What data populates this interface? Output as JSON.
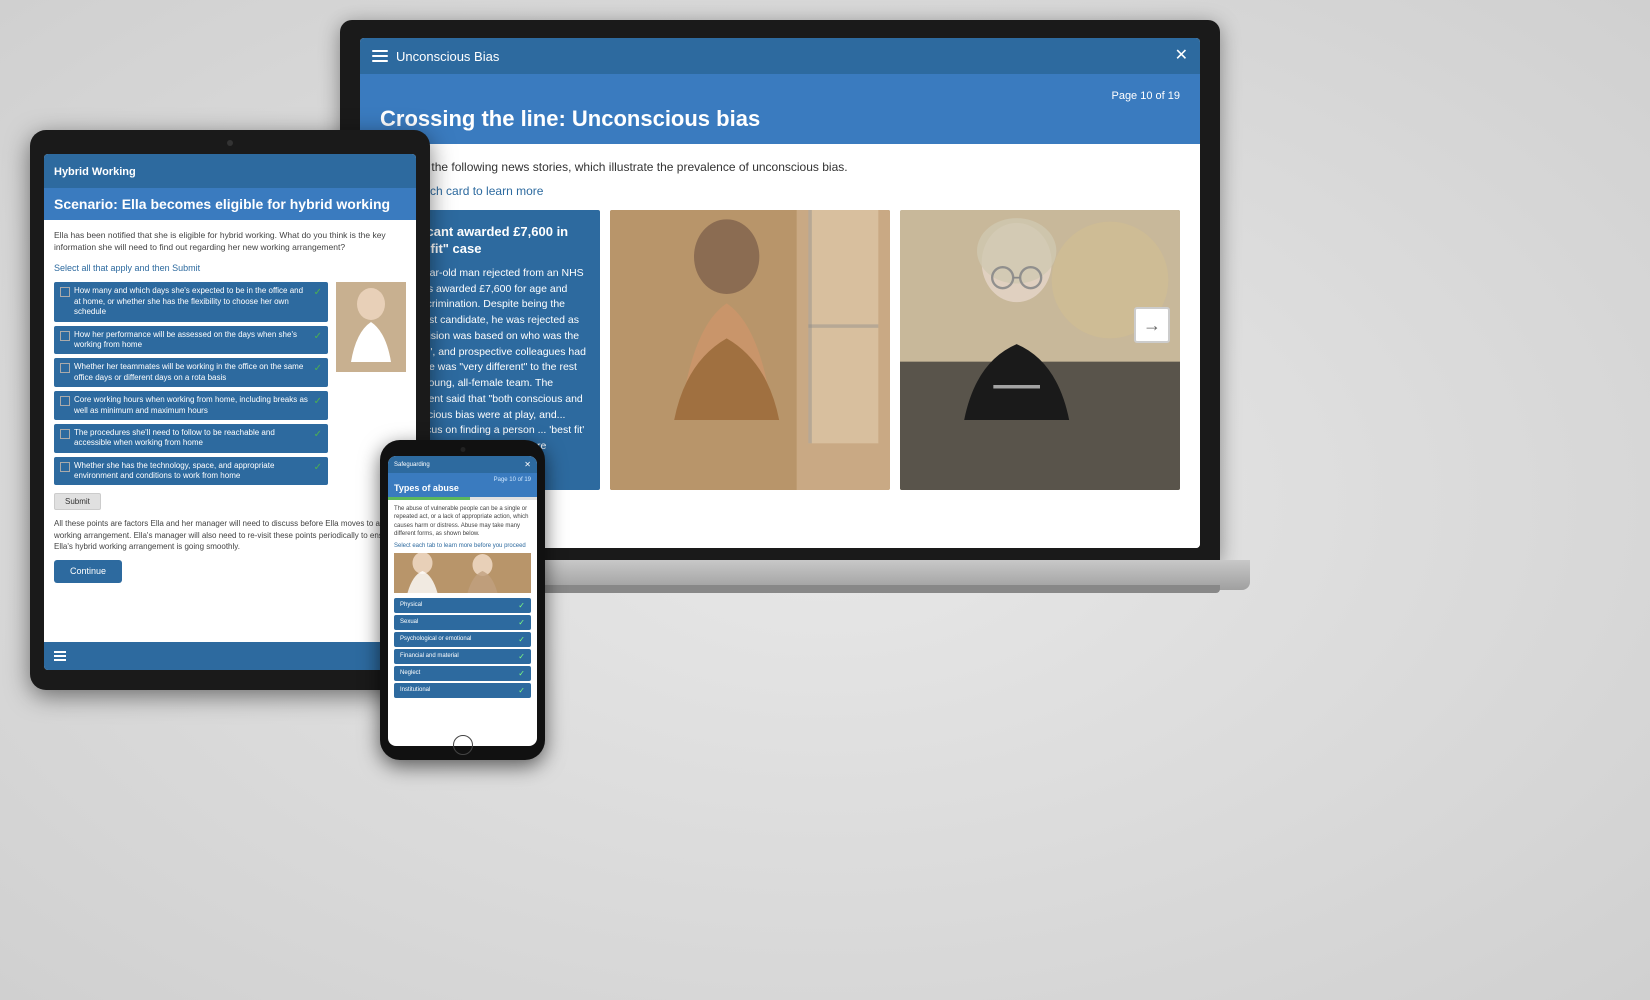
{
  "app": {
    "title": "Unconscious Bias",
    "close_label": "✕"
  },
  "laptop": {
    "header": {
      "title": "Unconscious Bias",
      "close": "✕"
    },
    "page_number": "Page 10 of 19",
    "page_title": "Crossing the line: Unconscious bias",
    "description": "Consider the following news stories, which illustrate the prevalence of unconscious bias.",
    "select_cards_text": "Select each card to learn more",
    "card": {
      "title": "Applicant awarded £7,600 in \"best fit\" case",
      "body": "A 50-year-old man rejected from an NHS role was awarded £7,600 for age and sex discrimination. Despite being the strongest candidate, he was rejected as the decision was based on who was the \"best fit\", and prospective colleagues had noted he was \"very different\" to the rest of the young, all-female team. The judgement said that \"both conscious and unconscious bias were at play, and... their focus on finding a person ... 'best fit' led them to take into ... that were discriminatory.\""
    }
  },
  "tablet": {
    "header_title": "Hybrid Working",
    "page_title": "Scenario: Ella becomes eligible for hybrid working",
    "body_text": "Ella has been notified that she is eligible for hybrid working. What do you think is the key information she will need to find out regarding her new working arrangement?",
    "select_text": "Select all that apply and then Submit",
    "checklist_items": [
      "How many and which days she's expected to be in the office and at home, or whether she has the flexibility to choose her own schedule",
      "How her performance will be assessed on the days when she's working from home",
      "Whether her teammates will be working in the office on the same office days or different days on a rota basis",
      "Core working hours when working from home, including breaks as well as minimum and maximum hours",
      "The procedures she'll need to follow to be reachable and accessible when working from home",
      "Whether she has the technology, space, and appropriate environment and conditions to work from home"
    ],
    "submit_label": "Submit",
    "footer_text": "All these points are factors Ella and her manager will need to discuss before Ella moves to a hybrid working arrangement. Ella's manager will also need to re-visit these points periodically to ensure Ella's hybrid working arrangement is going smoothly.",
    "continue_label": "Continue"
  },
  "phone": {
    "header_title": "Safeguarding",
    "page_number": "Page 10 of 19",
    "page_title": "Types of abuse",
    "close": "✕",
    "description": "The abuse of vulnerable people can be a single or repeated act, or a lack of appropriate action, which causes harm or distress. Abuse may take many different forms, as shown below.",
    "select_text": "Select each tab to learn more before you proceed",
    "tabs": [
      "Physical",
      "Sexual",
      "Psychological or emotional",
      "Financial and material",
      "Neglect",
      "Institutional"
    ]
  },
  "icons": {
    "hamburger": "☰",
    "close": "✕",
    "arrow_right": "→",
    "checkmark": "✓"
  }
}
